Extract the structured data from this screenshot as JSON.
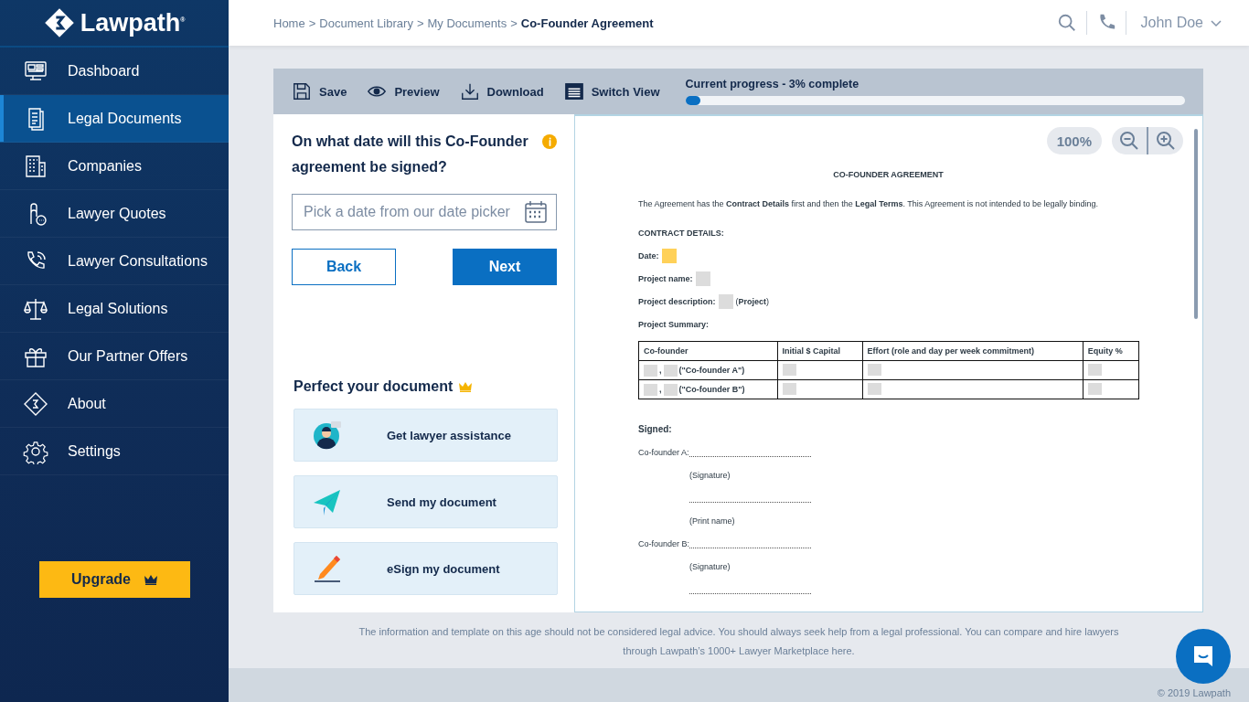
{
  "sidebar": {
    "logo": "Lawpath$^{®}$",
    "items": [
      {
        "label": "Dashboard",
        "selected": false
      },
      {
        "label": "Legal Documents",
        "selected": true
      },
      {
        "label": "Companies",
        "selected": false
      },
      {
        "label": "Lawyer Quotes",
        "selected": false
      },
      {
        "label": "Lawyer Consultations",
        "selected": false
      },
      {
        "label": "Legal Solutions",
        "selected": false
      },
      {
        "label": "Our Partner Offers",
        "selected": false
      },
      {
        "label": "About",
        "selected": false
      },
      {
        "label": "Settings",
        "selected": false
      }
    ],
    "upgrade": "Upgrade"
  },
  "header": {
    "breadcrumb": {
      "separator": ">",
      "items": [
        "Home",
        "Document Library",
        "My Documents",
        "Co-Founder Agreement"
      ]
    },
    "user": "John Doe"
  },
  "toolbar": {
    "actions": [
      "Save",
      "Preview",
      "Download",
      "Switch View"
    ],
    "progress": {
      "label": "Current progress - 3% complete",
      "level": 0.03
    }
  },
  "question": {
    "text": "On what date will this Co-Founder agreement be signed?",
    "field": {
      "placeholder": "Pick a date from our date picker"
    },
    "back": "Back",
    "next": "Next"
  },
  "perfect": {
    "title": "Perfect your document",
    "cards": [
      "Get lawyer assistance",
      "Send my document",
      "eSign my document"
    ]
  },
  "viewer": {
    "zoom": "100%"
  },
  "document": {
    "title": "CO-FOUNDER AGREEMENT",
    "intro": "The Agreement has the **Contract Details** first and then the **Legal Terms**. This Agreement is not intended to be legally binding.",
    "section": "**CONTRACT DETAILS**:",
    "fields": [
      {
        "label": "Date:",
        "highlighted": true
      },
      {
        "label": "Project name:",
        "highlighted": false
      },
      {
        "label": "Project description:",
        "highlighted": false,
        "suffix": "(**Project**)"
      }
    ],
    "summary": "Project Summary:",
    "table": {
      "columns": [
        "Co-founder",
        "Initial $ Capital",
        "Effort (role and day per week commitment)",
        "Equity %"
      ],
      "rows": [
        {
          "separator": ",",
          "name": "(\"Co-founder A\")"
        },
        {
          "separator": ",",
          "name": "(\"Co-founder B\")"
        }
      ]
    },
    "signed": "Signed:",
    "signature_lines": [
      {
        "kind": "line",
        "label": "Co-founder A:"
      },
      {
        "kind": "caption",
        "text": "(Signature)"
      },
      {
        "kind": "line"
      },
      {
        "kind": "caption",
        "text": "(Print name)"
      },
      {
        "kind": "line",
        "label": "Co-founder B:"
      },
      {
        "kind": "caption",
        "text": "(Signature)"
      },
      {
        "kind": "line"
      }
    ]
  },
  "disclaimer": "The information and template on this age should not be considered legal advice. You should always seek help from a legal professional. You can compare and hire lawyers through Lawpath’s 1000+ Lawyer Marketplace here.",
  "copyright": "© 2019 Lawpath"
}
